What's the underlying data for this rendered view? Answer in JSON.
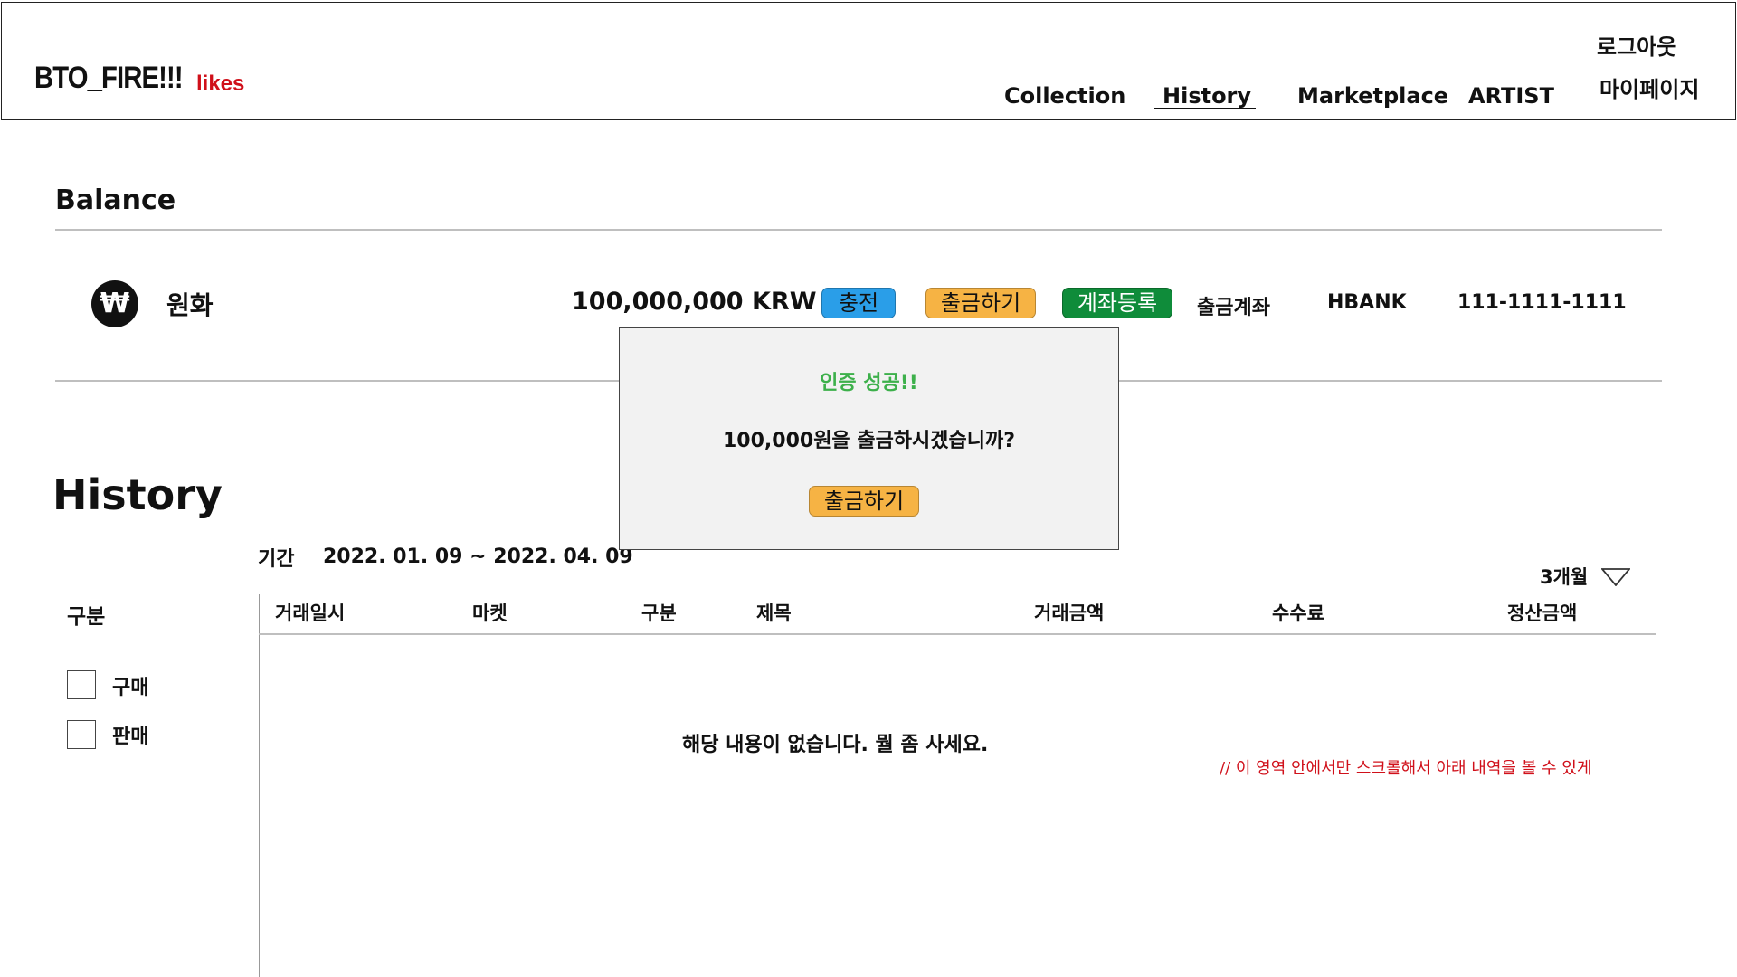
{
  "header": {
    "logo": "BTO_FIRE!!!",
    "logo_suffix": "likes",
    "nav": [
      "Collection",
      "History",
      "Marketplace",
      "ARTIST"
    ],
    "active_nav": "History",
    "logout": "로그아웃",
    "mypage": "마이페이지"
  },
  "balance": {
    "title": "Balance",
    "currency_symbol": "₩",
    "currency_name": "원화",
    "amount": "100,000,000 KRW",
    "buttons": {
      "charge": "충전",
      "withdraw": "출금하기",
      "register_account": "계좌등록"
    },
    "account_label": "출금계좌",
    "bank": "HBANK",
    "account_number": "111-1111-1111"
  },
  "modal": {
    "success": "인증 성공!!",
    "question": "100,000원을 출금하시겠습니까?",
    "confirm": "출금하기"
  },
  "history": {
    "title": "History",
    "period_label": "기간",
    "period_range": "2022. 01. 09 ~ 2022. 04. 09",
    "period_select": "3개월",
    "filter_title": "구분",
    "filters": [
      "구매",
      "판매"
    ],
    "columns": [
      "거래일시",
      "마켓",
      "구분",
      "제목",
      "거래금액",
      "수수료",
      "정산금액"
    ],
    "empty_message": "해당 내용이 없습니다. 뭘 좀 사세요.",
    "note": "// 이 영역 안에서만 스크롤해서 아래 내역을 볼 수 있게"
  },
  "colors": {
    "brand_red": "#d0101a",
    "charge_blue": "#2a9ee8",
    "withdraw_orange": "#f6b344",
    "register_green": "#0f8c3a",
    "success_green": "#3db04b"
  }
}
